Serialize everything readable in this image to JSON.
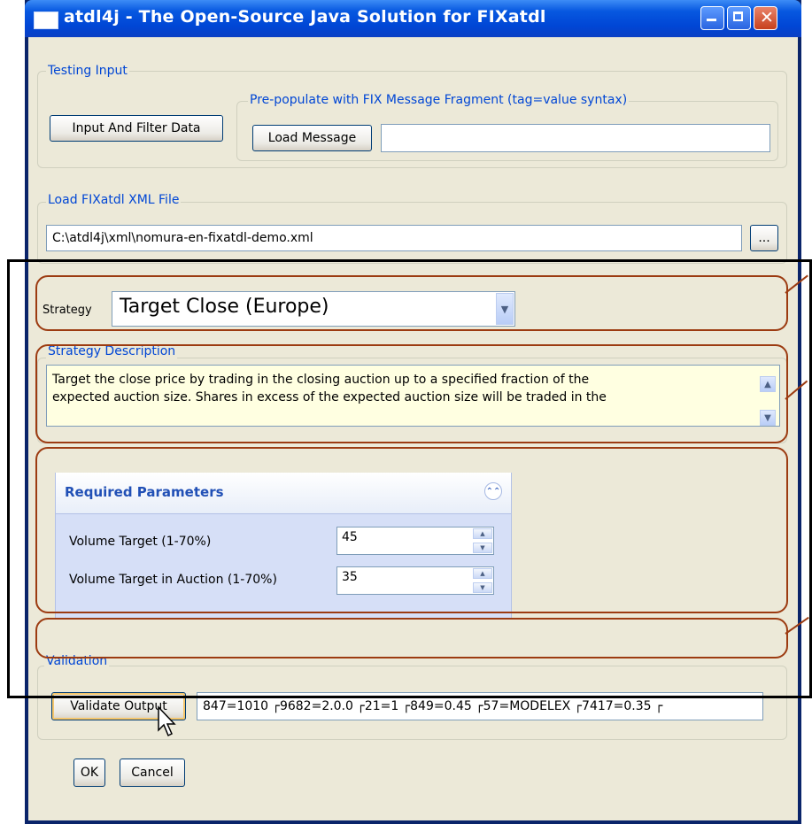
{
  "window": {
    "title": "atdl4j - The Open-Source Java Solution for FIXatdl"
  },
  "testing_input": {
    "group_label": "Testing Input",
    "input_filter_button": "Input And Filter Data",
    "prepopulate": {
      "group_label": "Pre-populate with FIX Message Fragment (tag=value syntax)",
      "load_button": "Load Message",
      "value": ""
    }
  },
  "load_file": {
    "group_label": "Load FIXatdl XML File",
    "path": "C:\\atdl4j\\xml\\nomura-en-fixatdl-demo.xml",
    "browse_button": "..."
  },
  "strategy": {
    "label": "Strategy",
    "selected": "Target Close (Europe)"
  },
  "description": {
    "group_label": "Strategy Description",
    "line1": "Target the close price by trading in the closing auction up to a specified fraction of the",
    "line2": "expected auction size.  Shares in excess of the expected auction size will be traded in the"
  },
  "required_parameters": {
    "title": "Required Parameters",
    "params": [
      {
        "label": "Volume Target (1-70%)",
        "value": "45"
      },
      {
        "label": "Volume Target in Auction (1-70%)",
        "value": "35"
      }
    ]
  },
  "validation": {
    "group_label": "Validation",
    "validate_button": "Validate Output",
    "output": "847=1010 ┌9682=2.0.0 ┌21=1 ┌849=0.45 ┌57=MODELEX ┌7417=0.35 ┌"
  },
  "footer": {
    "ok": "OK",
    "cancel": "Cancel"
  },
  "colors": {
    "annotation": "#9c3b11",
    "group_label": "#0046d5",
    "panel_title": "#2150b6"
  }
}
